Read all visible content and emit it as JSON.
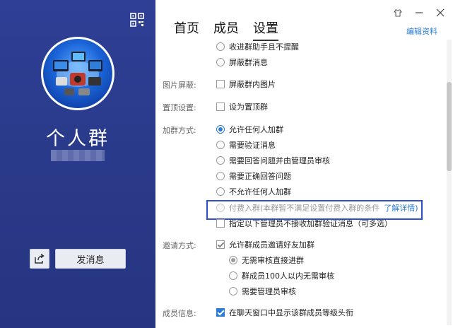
{
  "left_panel": {
    "group_name": "个人群",
    "send_button": "发消息"
  },
  "tabs": [
    {
      "label": "首页",
      "active": false
    },
    {
      "label": "成员",
      "active": false
    },
    {
      "label": "设置",
      "active": true
    }
  ],
  "edit_link": "编辑资料",
  "settings": {
    "receive_no_remind": "收进群助手且不提醒",
    "block_messages": "屏蔽群消息",
    "image_block_label": "图片屏蔽:",
    "image_block_option": "屏蔽群内图片",
    "pin_label": "置顶设置:",
    "pin_option": "设为置顶群",
    "join_label": "加群方式:",
    "join_options": [
      "允许任何人加群",
      "需要验证消息",
      "需要回答问题并由管理员审核",
      "需要正确回答问题",
      "不允许任何人加群"
    ],
    "paid_join": "付费入群(本群暂不满足设置付费入群的条件",
    "paid_join_link": "了解详情)",
    "admin_no_verify": "指定以下管理员不接收加群验证消息（可多选）",
    "invite_label": "邀请方式:",
    "invite_option": "允许群成员邀请好友加群",
    "invite_sub_options": [
      "无需审核直接进群",
      "群成员100人以内无需审核",
      "需要管理员审核"
    ],
    "member_info_label": "成员信息:",
    "member_info_option": "在聊天窗口中显示该群成员等级头衔"
  },
  "colors": {
    "left_bg": "#2a3a8c",
    "accent": "#2c7cd6",
    "highlight_box": "#2d50c8"
  }
}
